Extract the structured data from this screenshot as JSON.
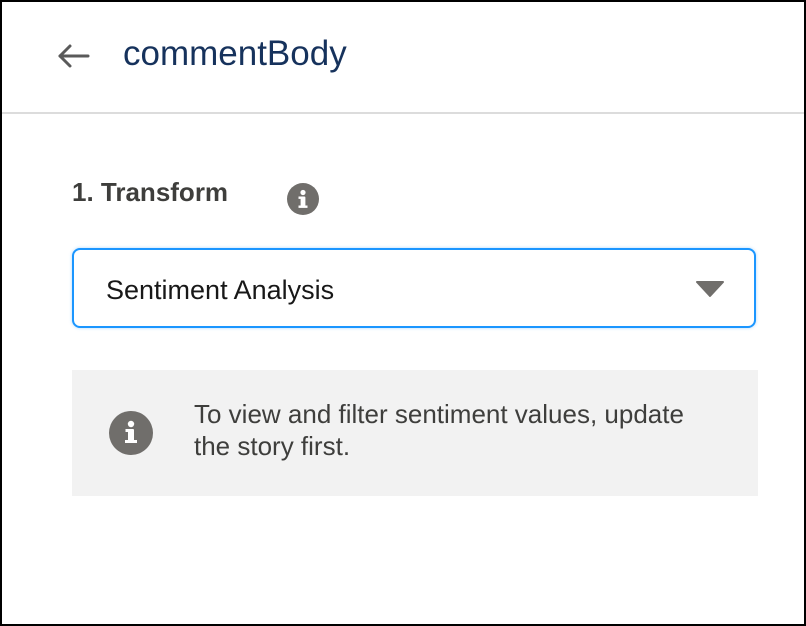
{
  "header": {
    "back_icon": "arrow-left-icon",
    "title": "commentBody"
  },
  "transform": {
    "label": "1. Transform",
    "info_icon": "info-icon",
    "select": {
      "value": "Sentiment Analysis",
      "caret_icon": "caret-down-icon"
    }
  },
  "notice": {
    "icon": "info-icon",
    "text": "To view and filter sentiment values, update the story first."
  },
  "colors": {
    "title": "#16325c",
    "label": "#3e3e3c",
    "focus_border": "#1b96ff",
    "icon_gray": "#706e6b",
    "notice_bg": "#f2f2f2",
    "divider": "#dcdcdc"
  }
}
